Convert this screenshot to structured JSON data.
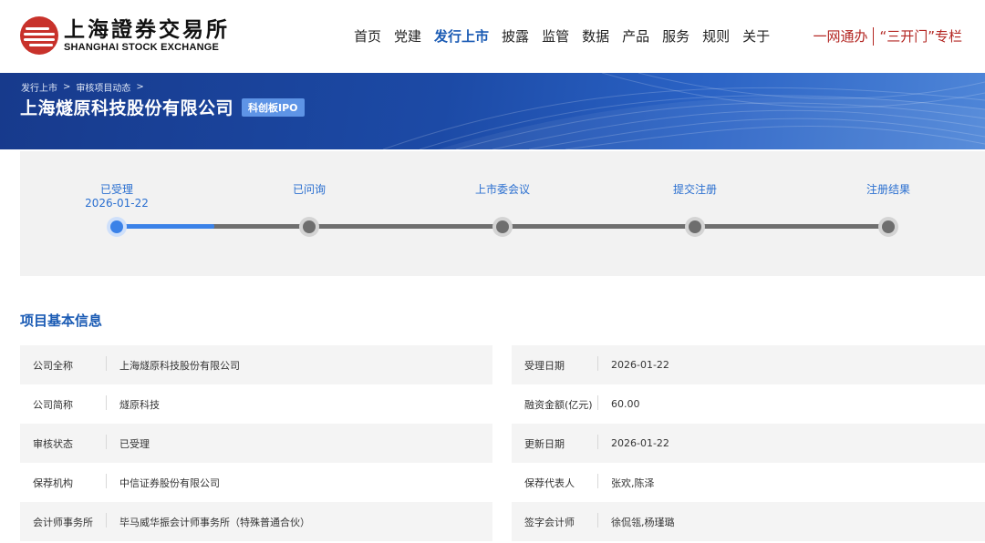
{
  "header": {
    "logo_cn": "上海證券交易所",
    "logo_en": "SHANGHAI STOCK EXCHANGE",
    "nav": [
      "首页",
      "党建",
      "发行上市",
      "披露",
      "监管",
      "数据",
      "产品",
      "服务",
      "规则",
      "关于"
    ],
    "nav_active": "发行上市",
    "quick_links": [
      "一网通办",
      "“三开门”专栏"
    ],
    "brand_color": "#c8322b",
    "accent_color": "#1a5bb4"
  },
  "banner": {
    "breadcrumbs": [
      "发行上市",
      "审核项目动态"
    ],
    "company_title": "上海燧原科技股份有限公司",
    "board_tag": "科创板IPO"
  },
  "progress": {
    "steps": [
      {
        "label": "已受理",
        "date": "2026-01-22",
        "status": "done"
      },
      {
        "label": "已问询",
        "date": "",
        "status": "pending"
      },
      {
        "label": "上市委会议",
        "date": "",
        "status": "pending"
      },
      {
        "label": "提交注册",
        "date": "",
        "status": "pending"
      },
      {
        "label": "注册结果",
        "date": "",
        "status": "pending"
      }
    ],
    "current_step_index": 0,
    "fill_fraction_of_first_segment": 0.5
  },
  "info": {
    "section_title": "项目基本信息",
    "left": [
      {
        "label": "公司全称",
        "value": "上海燧原科技股份有限公司"
      },
      {
        "label": "公司简称",
        "value": "燧原科技"
      },
      {
        "label": "审核状态",
        "value": "已受理"
      },
      {
        "label": "保荐机构",
        "value": "中信证券股份有限公司"
      },
      {
        "label": "会计师事务所",
        "value": "毕马威华振会计师事务所（特殊普通合伙）"
      }
    ],
    "right": [
      {
        "label": "受理日期",
        "value": "2026-01-22"
      },
      {
        "label": "融资金额(亿元)",
        "value": "60.00"
      },
      {
        "label": "更新日期",
        "value": "2026-01-22"
      },
      {
        "label": "保荐代表人",
        "value": "张欢,陈泽"
      },
      {
        "label": "签字会计师",
        "value": "徐侃瓴,杨瑾璐"
      }
    ]
  }
}
